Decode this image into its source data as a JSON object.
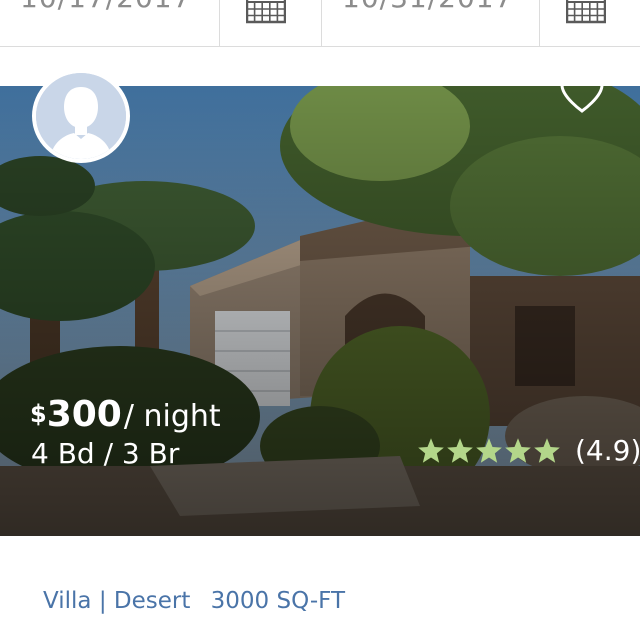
{
  "search": {
    "checkin_date": "10/17/2017",
    "checkout_date": "10/31/2017",
    "calendar_icon": "calendar-icon"
  },
  "listing": {
    "currency": "$",
    "price": "300",
    "per_night": "/ night",
    "beds_baths": "4 Bd / 3 Br",
    "rating_value": 4.9,
    "rating_text": "(4.9)",
    "stars": 5,
    "star_color": "#b3d68a",
    "host_avatar_icon": "avatar-icon",
    "favorite_icon": "heart-icon",
    "type": "Villa",
    "separator": "|",
    "location": "Desert",
    "size": "3000 SQ-FT"
  },
  "colors": {
    "link": "#4a74a8",
    "divider": "#dcdcdc",
    "date_text": "#8c8c8c"
  }
}
